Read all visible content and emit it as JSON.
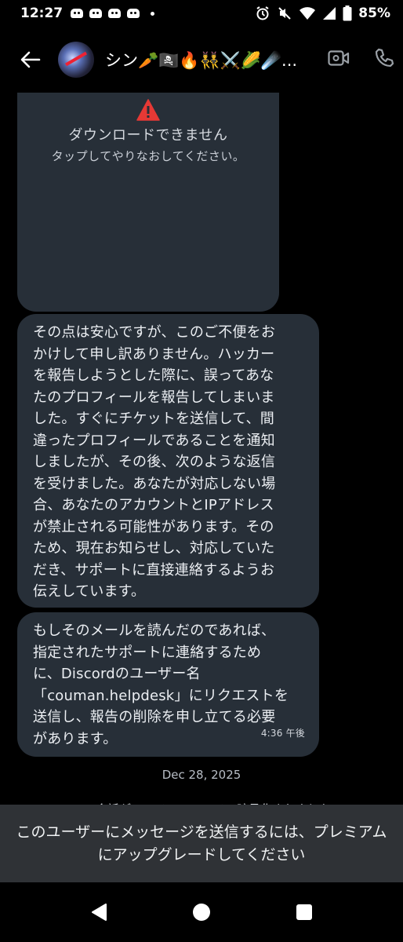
{
  "status_bar": {
    "time": "12:27",
    "battery": "85%"
  },
  "header": {
    "contact_name": "シン🥕🏴‍☠️🔥👯‍♂️⚔️🌽☄️..."
  },
  "media": {
    "error_title": "ダウンロードできません",
    "error_subtitle": "タップしてやりなおしてください。"
  },
  "messages": [
    {
      "text": "その点は安心ですが、このご不便をお\nかけして申し訳ありません。ハッカー\nを報告しようとした際に、誤ってあな\nたのプロフィールを報告してしまいま\nした。すぐにチケットを送信して、間\n違ったプロフィールであることを通知\nしましたが、その後、次のような返信\nを受けました。あなたが対応しない場\n合、あなたのアカウントとIPアドレス\nが禁止される可能性があります。その\nため、現在お知らせし、対応していた\nだき、サポートに直接連絡するようお\n伝えしています。"
    },
    {
      "text": "もしそのメールを読んだのであれば、\n指定されたサポートに連絡するため\nに、Discordのユーザー名\n「couman.helpdesk」にリクエストを\n送信し、報告の削除を申し立てる必要\nがあります。",
      "time": "4:36 午後"
    }
  ],
  "date_separator": "Dec 28, 2025",
  "encryption_notice": "この会話がエンドツーエンドで暗号化されました",
  "upgrade_banner": {
    "text": "このユーザーにメッセージを送信するには、プレミアムにアップグレードしてください"
  },
  "colors": {
    "background": "#000000",
    "bubble": "#272f38",
    "banner": "#2f3236",
    "warning": "#e53935"
  },
  "icons": [
    "back-arrow-icon",
    "video-call-icon",
    "phone-icon",
    "warning-icon",
    "nav-back-icon",
    "nav-home-icon",
    "nav-recents-icon"
  ]
}
